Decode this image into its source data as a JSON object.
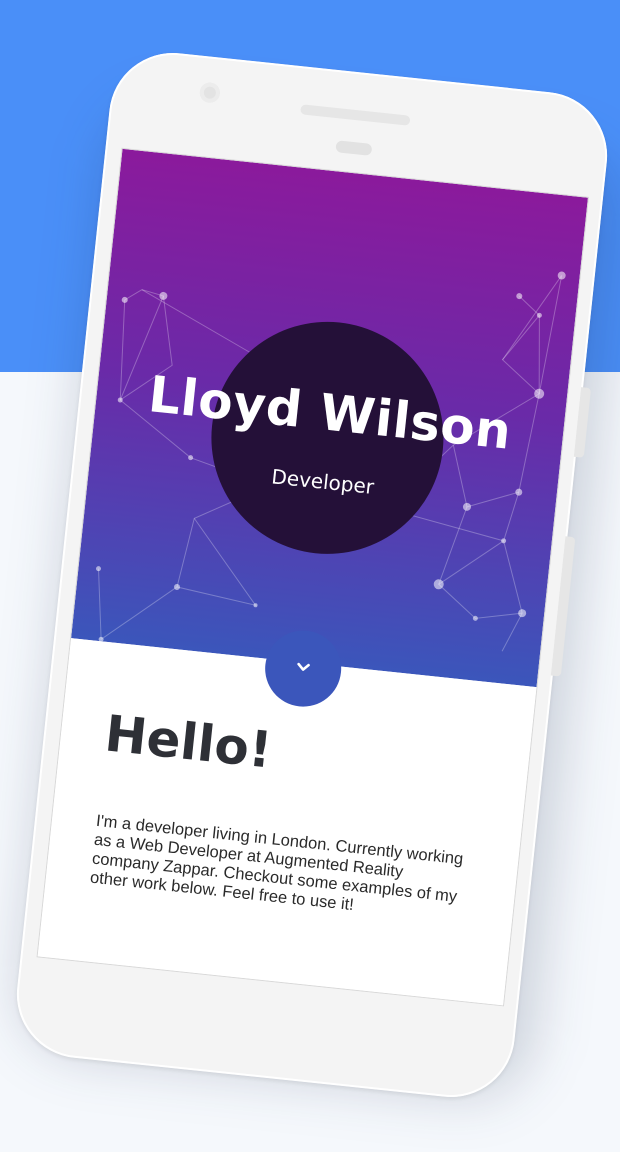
{
  "profile": {
    "name": "Lloyd Wilson",
    "role": "Developer"
  },
  "scroll_indicator": {
    "icon": "chevron-down-icon"
  },
  "intro": {
    "heading": "Hello!",
    "text": "I'm a developer living in London. Currently working as a Web Developer at Augmented Reality company Zappar. Checkout some examples of my other work below. Feel free to use it!"
  },
  "colors": {
    "page_top": "#4a8ff8",
    "page_bottom": "#f5f8fc",
    "hero_top": "#8b1a9c",
    "hero_bottom": "#3b56bb",
    "name_circle": "#241038"
  }
}
